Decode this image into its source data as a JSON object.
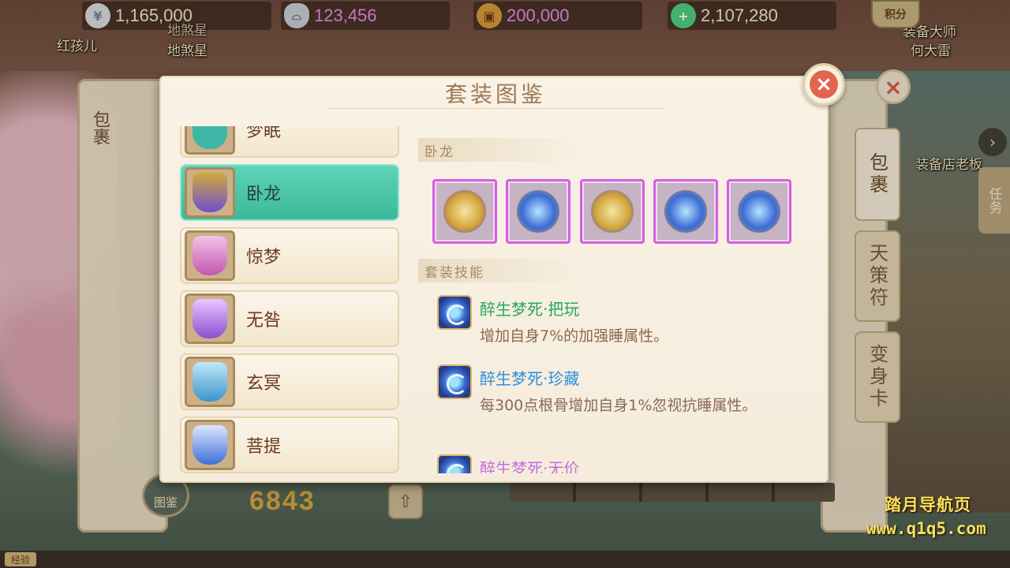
{
  "currencies": [
    {
      "icon": "silver-coin-icon",
      "value": "1,165,000",
      "color": "#f3e9c2"
    },
    {
      "icon": "silver-ingot-icon",
      "value": "123,456",
      "color": "#e98de9"
    },
    {
      "icon": "copper-coin-icon",
      "value": "200,000",
      "color": "#e98de9"
    },
    {
      "icon": "jade-money-icon",
      "value": "2,107,280",
      "color": "#f3e9c2"
    }
  ],
  "npcs": {
    "left_name": "红孩儿",
    "center_name_1": "地煞星",
    "center_name_2": "地煞星",
    "right_title": "装备大师",
    "right_name": "何大雷",
    "shop_owner": "装备店老板"
  },
  "points_badge": "积分",
  "task_tab": "任务",
  "background": {
    "left_tab": "包裹",
    "right_tabs": [
      "包裹",
      "天策符",
      "变身卡"
    ],
    "score": "6843",
    "atlas_button": "图鉴",
    "exp_label": "经验"
  },
  "modal": {
    "title": "套装图鉴",
    "sets": [
      {
        "name": "梦眠",
        "color": "#3fb7a6"
      },
      {
        "name": "卧龙",
        "color": "#d2a93b"
      },
      {
        "name": "惊梦",
        "color": "#e38bd2"
      },
      {
        "name": "无咎",
        "color": "#a66ad8"
      },
      {
        "name": "玄冥",
        "color": "#4aa6d6"
      },
      {
        "name": "菩提",
        "color": "#4b7fd8"
      }
    ],
    "active_set": "卧龙",
    "pieces_heading": "卧龙",
    "piece_colors": [
      "#d3a53a",
      "#3b6bd6",
      "#d3a53a",
      "#3b6bd6",
      "#3b6bd6"
    ],
    "skills_heading": "套装技能",
    "skills": [
      {
        "name": "醉生梦死·把玩",
        "desc": "增加自身7%的加强睡属性。",
        "color": "#23a95a"
      },
      {
        "name": "醉生梦死·珍藏",
        "desc": "每300点根骨增加自身1%忽视抗睡属性。",
        "color": "#2e8fe0"
      },
      {
        "name": "醉生梦死·无价",
        "desc": "",
        "color": "#c56ce0"
      }
    ]
  },
  "watermark": {
    "line1": "踏月导航页",
    "line2": "www.q1q5.com"
  }
}
